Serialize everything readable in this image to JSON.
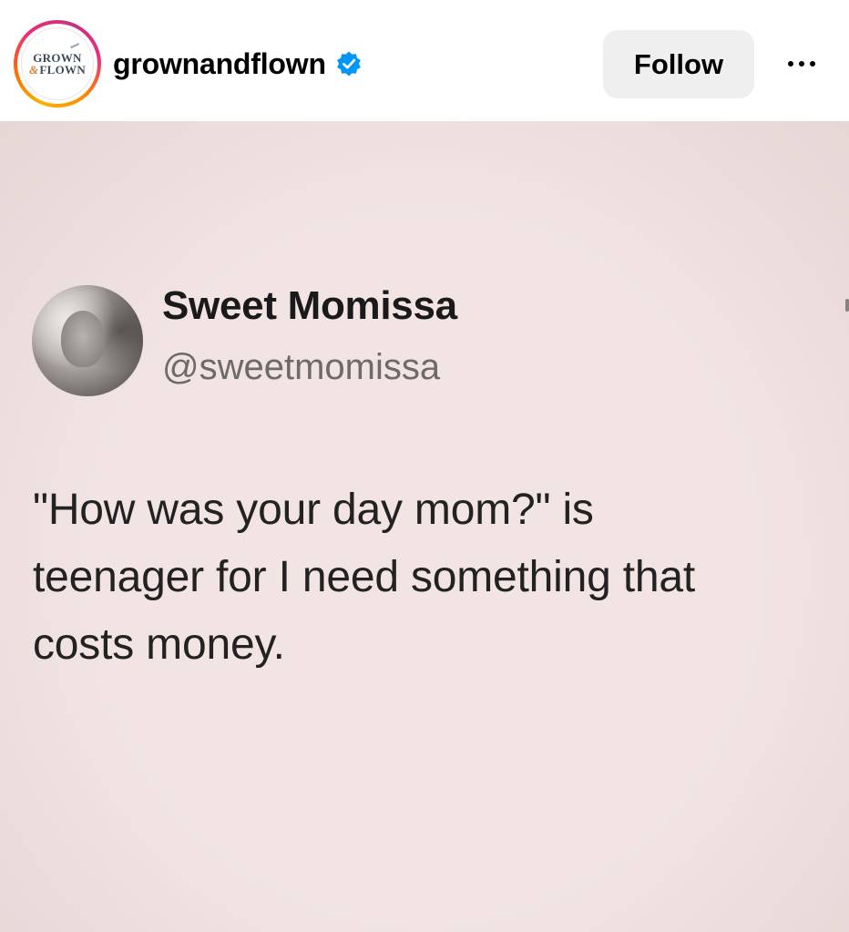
{
  "header": {
    "avatar": {
      "icon": "grown-and-flown-logo",
      "line1": "GROWN",
      "amp": "&",
      "line2": "FLOWN"
    },
    "username": "grownandflown",
    "verified_icon": "verified-badge-icon",
    "follow_label": "Follow",
    "more_icon": "more-options-icon"
  },
  "post": {
    "tweet": {
      "display_name": "Sweet Momissa",
      "handle": "@sweetmomissa",
      "avatar_icon": "profile-photo",
      "text_lines": [
        "\"How was your day mom?\" is",
        "teenager for I need something that",
        "costs money."
      ]
    }
  },
  "colors": {
    "follow_bg": "#efefef",
    "verified_blue": "#0095f6",
    "post_bg": "#f1e4e3"
  }
}
